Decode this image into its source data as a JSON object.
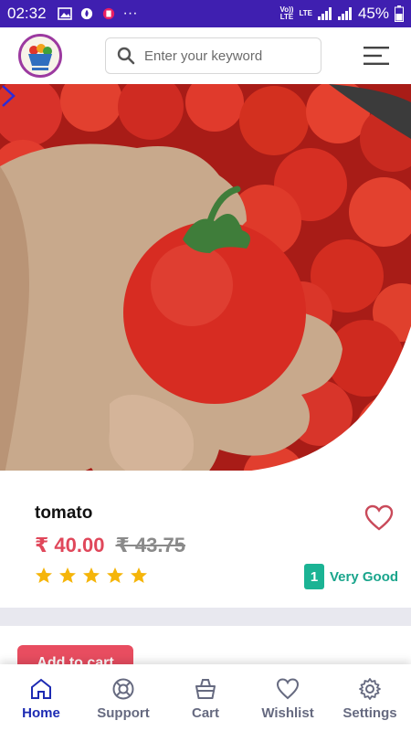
{
  "status_bar": {
    "time": "02:32",
    "more": "···",
    "volte": "Vo))\nLTE",
    "lte": "LTE",
    "battery": "45%"
  },
  "header": {
    "search_placeholder": "Enter your keyword"
  },
  "product": {
    "name": "tomato",
    "price": "₹ 40.00",
    "old_price": "₹ 43.75",
    "stars": 5,
    "rating_value": "1",
    "rating_text": "Very Good",
    "add_to_cart": "Add to cart"
  },
  "nav": {
    "items": [
      {
        "label": "Home",
        "icon": "home-icon",
        "active": true
      },
      {
        "label": "Support",
        "icon": "lifebuoy-icon",
        "active": false
      },
      {
        "label": "Cart",
        "icon": "basket-icon",
        "active": false
      },
      {
        "label": "Wishlist",
        "icon": "heart-icon",
        "active": false
      },
      {
        "label": "Settings",
        "icon": "gear-icon",
        "active": false
      }
    ]
  },
  "colors": {
    "status_bar": "#3f1fb0",
    "price": "#e0475a",
    "rating": "#1bb394",
    "active_nav": "#1d2bb3",
    "star": "#f5b50a"
  }
}
